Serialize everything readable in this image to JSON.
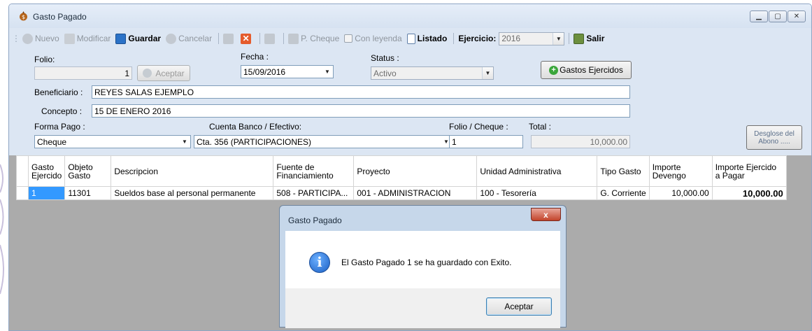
{
  "window": {
    "title": "Gasto Pagado",
    "buttons": [
      "minimize",
      "maximize",
      "close"
    ]
  },
  "toolbar": {
    "nuevo": "Nuevo",
    "modificar": "Modificar",
    "guardar": "Guardar",
    "cancelar": "Cancelar",
    "cheque": "P. Cheque",
    "con_leyenda": "Con leyenda",
    "listado": "Listado",
    "ejercicio_label": "Ejercicio:",
    "ejercicio_value": "2016",
    "salir": "Salir"
  },
  "form": {
    "folio_label": "Folio:",
    "folio_value": "1",
    "aceptar_label": "Aceptar",
    "fecha_label": "Fecha :",
    "fecha_value": "15/09/2016",
    "status_label": "Status :",
    "status_value": "Activo",
    "gastos_ejercidos_label": "Gastos Ejercidos",
    "beneficiario_label": "Beneficiario :",
    "beneficiario_value": "REYES SALAS EJEMPLO",
    "concepto_label": "Concepto :",
    "concepto_value": "15 DE ENERO 2016",
    "forma_pago_label": "Forma Pago :",
    "forma_pago_value": "Cheque",
    "cuenta_label": "Cuenta Banco / Efectivo:",
    "cuenta_value": "Cta. 356 (PARTICIPACIONES)",
    "folio_cheque_label": "Folio / Cheque :",
    "folio_cheque_value": "1",
    "total_label": "Total :",
    "total_value": "10,000.00",
    "desglose_label": "Desglose del Abono ....."
  },
  "grid": {
    "columns": [
      "Gasto Ejercido",
      "Objeto Gasto",
      "Descripcion",
      "Fuente de Financiamiento",
      "Proyecto",
      "Unidad Administrativa",
      "Tipo Gasto",
      "Importe Devengo",
      "Importe Ejercido a Pagar"
    ],
    "rows": [
      [
        "1",
        "11301",
        "Sueldos base al personal permanente",
        "508 - PARTICIPA...",
        "001 - ADMINISTRACION",
        "100 - Tesorería",
        "G. Corriente",
        "10,000.00",
        "10,000.00"
      ]
    ]
  },
  "dialog": {
    "title": "Gasto Pagado",
    "close": "x",
    "message": "El Gasto Pagado 1 se ha guardado con Exito.",
    "ok_label": "Aceptar"
  }
}
